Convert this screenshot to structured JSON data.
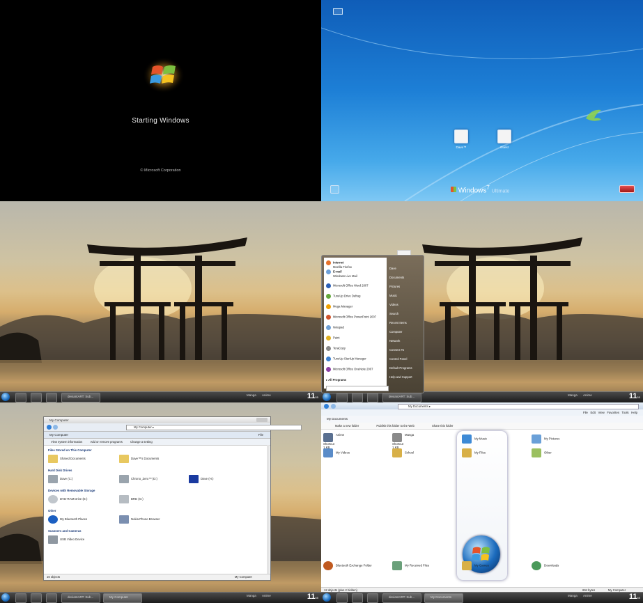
{
  "boot": {
    "title": "Starting Windows",
    "copyright": "© Microsoft Corporation"
  },
  "login": {
    "users": [
      {
        "name": "Dave™"
      },
      {
        "name": "Guest"
      }
    ],
    "brand": "Windows",
    "brand_version": "7",
    "edition": "Ultimate"
  },
  "taskbar": {
    "task_label": "deviantART: Sub...",
    "tray_items": [
      "Manga",
      "Anime"
    ],
    "clock": "11",
    "clock_minutes": "55"
  },
  "start_menu": {
    "pinned": [
      {
        "title": "Internet",
        "sub": "Mozilla Firefox",
        "color": "#e6712a"
      },
      {
        "title": "E-mail",
        "sub": "Windows Live Mail",
        "color": "#6da0d9"
      }
    ],
    "recent": [
      {
        "label": "Microsoft Office Word 2007",
        "color": "#2b5fb5"
      },
      {
        "label": "TuneUp Drive Defrag",
        "color": "#64a83c"
      },
      {
        "label": "Mega Manager",
        "color": "#f0a000"
      },
      {
        "label": "Microsoft Office PowerPoint 2007",
        "color": "#d1542c"
      },
      {
        "label": "Notepad",
        "color": "#6fa0d5"
      },
      {
        "label": "Paint",
        "color": "#e0b020"
      },
      {
        "label": "TeraCopy",
        "color": "#888888"
      },
      {
        "label": "TuneUp StartUp Manager",
        "color": "#3a7fd0"
      },
      {
        "label": "Microsoft Office OneNote 2007",
        "color": "#8a3fa5"
      }
    ],
    "all_programs": "All Programs",
    "right": [
      "Dave",
      "Documents",
      "Pictures",
      "Music",
      "Videos",
      "Search",
      "Recent Items",
      "Computer",
      "Network",
      "Connect To",
      "Control Panel",
      "Default Programs",
      "Help and Support"
    ]
  },
  "explorer": {
    "title": "My Computer",
    "address": "My Computer",
    "tab": "My Computer",
    "file_menu": "File",
    "commands": [
      "View system information",
      "Add or remove programs",
      "Change a setting"
    ],
    "groups": [
      {
        "title": "Files Stored on This Computer",
        "items": [
          {
            "label": "Shared Documents",
            "color": "#e8c860"
          },
          {
            "label": "Dave™'s Documents",
            "color": "#e8c860"
          }
        ]
      },
      {
        "title": "Hard Disk Drives",
        "items": [
          {
            "label": "Dave (C:)",
            "color": "#9aa4ad"
          },
          {
            "label": "Chrono_Zero™ (D:)",
            "color": "#9aa4ad"
          },
          {
            "label": "Dave (H:)",
            "color": "#1a3aa0"
          }
        ]
      },
      {
        "title": "Devices with Removable Storage",
        "items": [
          {
            "label": "DVD-RAM Drive (E:)",
            "color": "#c0c6cc"
          },
          {
            "label": "BRD (G:)",
            "color": "#b6bcc2"
          }
        ]
      },
      {
        "title": "Other",
        "items": [
          {
            "label": "My Bluetooth Places",
            "color": "#1b5fc2"
          },
          {
            "label": "Nokia Phone Browser",
            "color": "#7b8fb0"
          }
        ]
      },
      {
        "title": "Scanners and Cameras",
        "items": [
          {
            "label": "USB Video Device",
            "color": "#8f98a1"
          }
        ]
      }
    ],
    "status_left": "16 objects",
    "status_right": "My Computer"
  },
  "documents": {
    "address": "My Documents",
    "tab": "My Documents",
    "menu": [
      "File",
      "Edit",
      "View",
      "Favorites",
      "Tools",
      "Help"
    ],
    "commands": [
      "Make a new folder",
      "Publish this folder to the Web",
      "Share this folder"
    ],
    "items": [
      {
        "label": "Anime",
        "sub": "Shortcut",
        "size": "1 KB",
        "color": "#5a7090"
      },
      {
        "label": "Manga",
        "sub": "Shortcut",
        "size": "1 KB",
        "color": "#8a8a8a"
      },
      {
        "label": "My Music",
        "color": "#3e8ad6"
      },
      {
        "label": "My Pictures",
        "color": "#6aa0d8"
      },
      {
        "label": "My Videos",
        "color": "#5a8cc8"
      },
      {
        "label": "School",
        "color": "#d8b048"
      },
      {
        "label": "My Files",
        "color": "#d8b048"
      },
      {
        "label": "Other",
        "color": "#9bc060"
      },
      {
        "label": "Bluetooth Exchange Folder",
        "color": "#c05a20"
      },
      {
        "label": "My Received Files",
        "color": "#6aa07a"
      },
      {
        "label": "My Games",
        "color": "#d8b048"
      },
      {
        "label": "Downloads",
        "color": "#4a9a5a"
      }
    ],
    "status_left": "12 objects (plus 2 hidden)",
    "status_mid": "694 bytes",
    "status_right": "My Computer"
  }
}
